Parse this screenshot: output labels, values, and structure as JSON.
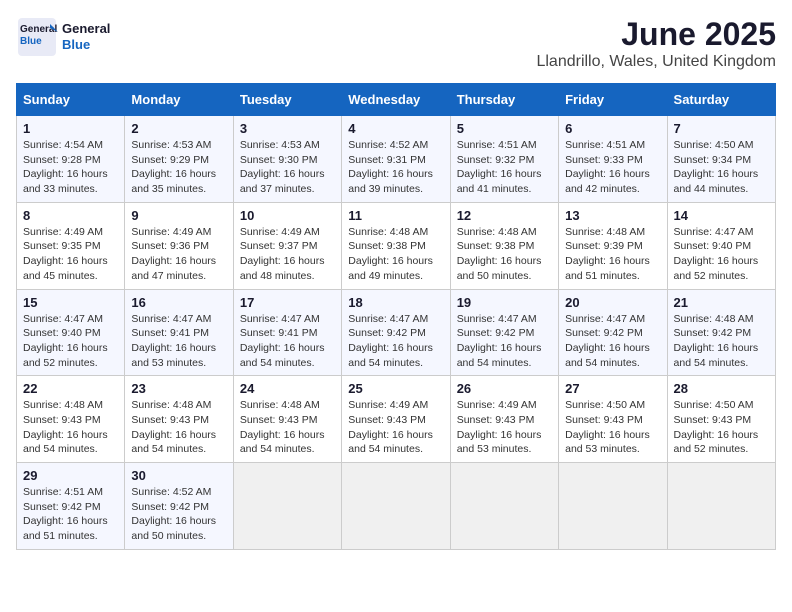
{
  "logo": {
    "line1": "General",
    "line2": "Blue"
  },
  "title": "June 2025",
  "subtitle": "Llandrillo, Wales, United Kingdom",
  "days_of_week": [
    "Sunday",
    "Monday",
    "Tuesday",
    "Wednesday",
    "Thursday",
    "Friday",
    "Saturday"
  ],
  "weeks": [
    [
      {
        "day": "1",
        "sunrise": "4:54 AM",
        "sunset": "9:28 PM",
        "daylight": "16 hours and 33 minutes."
      },
      {
        "day": "2",
        "sunrise": "4:53 AM",
        "sunset": "9:29 PM",
        "daylight": "16 hours and 35 minutes."
      },
      {
        "day": "3",
        "sunrise": "4:53 AM",
        "sunset": "9:30 PM",
        "daylight": "16 hours and 37 minutes."
      },
      {
        "day": "4",
        "sunrise": "4:52 AM",
        "sunset": "9:31 PM",
        "daylight": "16 hours and 39 minutes."
      },
      {
        "day": "5",
        "sunrise": "4:51 AM",
        "sunset": "9:32 PM",
        "daylight": "16 hours and 41 minutes."
      },
      {
        "day": "6",
        "sunrise": "4:51 AM",
        "sunset": "9:33 PM",
        "daylight": "16 hours and 42 minutes."
      },
      {
        "day": "7",
        "sunrise": "4:50 AM",
        "sunset": "9:34 PM",
        "daylight": "16 hours and 44 minutes."
      }
    ],
    [
      {
        "day": "8",
        "sunrise": "4:49 AM",
        "sunset": "9:35 PM",
        "daylight": "16 hours and 45 minutes."
      },
      {
        "day": "9",
        "sunrise": "4:49 AM",
        "sunset": "9:36 PM",
        "daylight": "16 hours and 47 minutes."
      },
      {
        "day": "10",
        "sunrise": "4:49 AM",
        "sunset": "9:37 PM",
        "daylight": "16 hours and 48 minutes."
      },
      {
        "day": "11",
        "sunrise": "4:48 AM",
        "sunset": "9:38 PM",
        "daylight": "16 hours and 49 minutes."
      },
      {
        "day": "12",
        "sunrise": "4:48 AM",
        "sunset": "9:38 PM",
        "daylight": "16 hours and 50 minutes."
      },
      {
        "day": "13",
        "sunrise": "4:48 AM",
        "sunset": "9:39 PM",
        "daylight": "16 hours and 51 minutes."
      },
      {
        "day": "14",
        "sunrise": "4:47 AM",
        "sunset": "9:40 PM",
        "daylight": "16 hours and 52 minutes."
      }
    ],
    [
      {
        "day": "15",
        "sunrise": "4:47 AM",
        "sunset": "9:40 PM",
        "daylight": "16 hours and 52 minutes."
      },
      {
        "day": "16",
        "sunrise": "4:47 AM",
        "sunset": "9:41 PM",
        "daylight": "16 hours and 53 minutes."
      },
      {
        "day": "17",
        "sunrise": "4:47 AM",
        "sunset": "9:41 PM",
        "daylight": "16 hours and 54 minutes."
      },
      {
        "day": "18",
        "sunrise": "4:47 AM",
        "sunset": "9:42 PM",
        "daylight": "16 hours and 54 minutes."
      },
      {
        "day": "19",
        "sunrise": "4:47 AM",
        "sunset": "9:42 PM",
        "daylight": "16 hours and 54 minutes."
      },
      {
        "day": "20",
        "sunrise": "4:47 AM",
        "sunset": "9:42 PM",
        "daylight": "16 hours and 54 minutes."
      },
      {
        "day": "21",
        "sunrise": "4:48 AM",
        "sunset": "9:42 PM",
        "daylight": "16 hours and 54 minutes."
      }
    ],
    [
      {
        "day": "22",
        "sunrise": "4:48 AM",
        "sunset": "9:43 PM",
        "daylight": "16 hours and 54 minutes."
      },
      {
        "day": "23",
        "sunrise": "4:48 AM",
        "sunset": "9:43 PM",
        "daylight": "16 hours and 54 minutes."
      },
      {
        "day": "24",
        "sunrise": "4:48 AM",
        "sunset": "9:43 PM",
        "daylight": "16 hours and 54 minutes."
      },
      {
        "day": "25",
        "sunrise": "4:49 AM",
        "sunset": "9:43 PM",
        "daylight": "16 hours and 54 minutes."
      },
      {
        "day": "26",
        "sunrise": "4:49 AM",
        "sunset": "9:43 PM",
        "daylight": "16 hours and 53 minutes."
      },
      {
        "day": "27",
        "sunrise": "4:50 AM",
        "sunset": "9:43 PM",
        "daylight": "16 hours and 53 minutes."
      },
      {
        "day": "28",
        "sunrise": "4:50 AM",
        "sunset": "9:43 PM",
        "daylight": "16 hours and 52 minutes."
      }
    ],
    [
      {
        "day": "29",
        "sunrise": "4:51 AM",
        "sunset": "9:42 PM",
        "daylight": "16 hours and 51 minutes."
      },
      {
        "day": "30",
        "sunrise": "4:52 AM",
        "sunset": "9:42 PM",
        "daylight": "16 hours and 50 minutes."
      },
      null,
      null,
      null,
      null,
      null
    ]
  ],
  "labels": {
    "sunrise": "Sunrise: ",
    "sunset": "Sunset: ",
    "daylight": "Daylight: "
  }
}
